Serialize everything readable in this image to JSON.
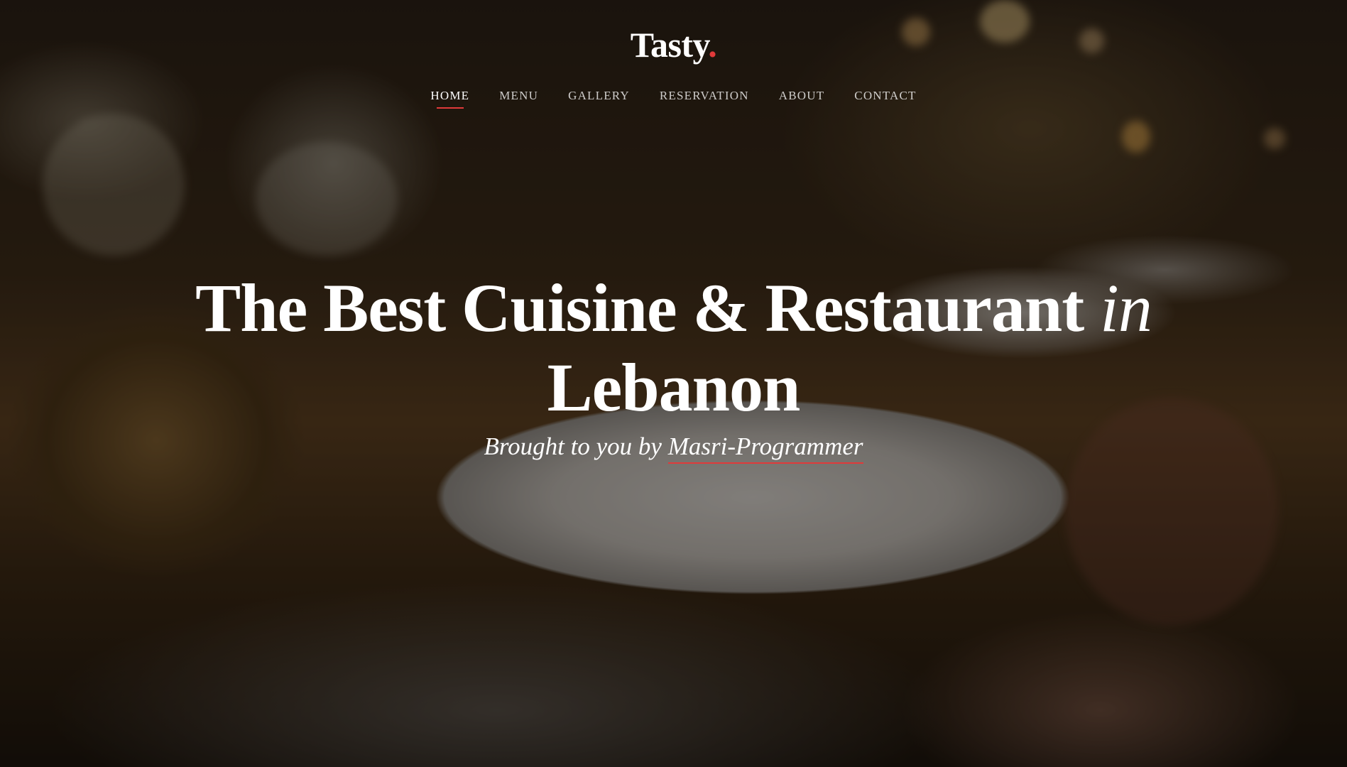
{
  "site": {
    "brand": "Tasty",
    "brand_dot": ".",
    "accent_color": "#e03a3a"
  },
  "nav": {
    "items": [
      {
        "label": "HOME",
        "active": true
      },
      {
        "label": "MENU",
        "active": false
      },
      {
        "label": "GALLERY",
        "active": false
      },
      {
        "label": "RESERVATION",
        "active": false
      },
      {
        "label": "ABOUT",
        "active": false
      },
      {
        "label": "CONTACT",
        "active": false
      }
    ]
  },
  "hero": {
    "headline_line1_main": "The Best Cuisine & Restaurant ",
    "headline_line1_italic": "in",
    "headline_line2": "Lebanon",
    "subtitle_prefix": "Brought to you by ",
    "subtitle_author": "Masri-Programmer",
    "background_image": "restaurant table with plated dish, bread basket and wine glasses"
  }
}
